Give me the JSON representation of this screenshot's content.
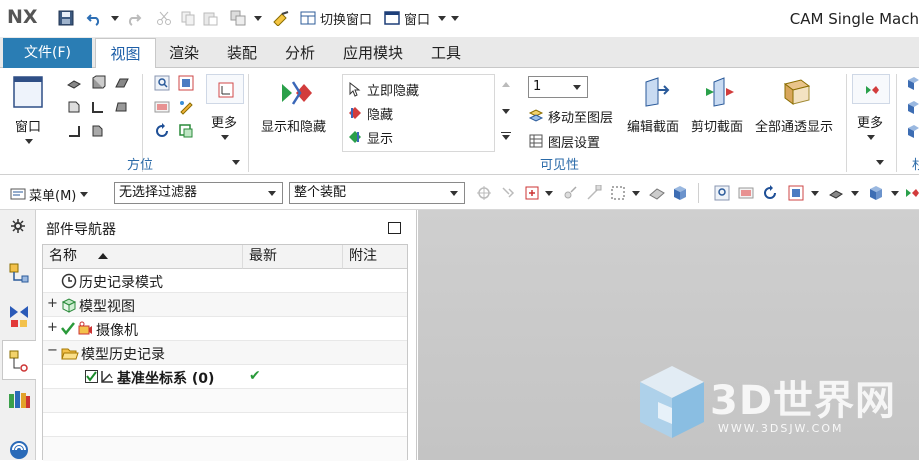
{
  "app": {
    "logo": "NX",
    "title": "CAM Single Mach"
  },
  "quick_access": {
    "switch_window_label": "切换窗口",
    "window_label": "窗口"
  },
  "menu_tabs": {
    "file": "文件(F)",
    "tabs": [
      "视图",
      "渲染",
      "装配",
      "分析",
      "应用模块",
      "工具"
    ]
  },
  "ribbon": {
    "window_btn": "窗口",
    "more_btn_1": "更多",
    "group_orientation": "方位",
    "show_hide_btn": "显示和隐藏",
    "immediate_hide": "立即隐藏",
    "hide": "隐藏",
    "show": "显示",
    "layer_value": "1",
    "move_to_layer": "移动至图层",
    "layer_settings": "图层设置",
    "group_visibility": "可见性",
    "edit_section": "编辑截面",
    "clip_section": "剪切截面",
    "all_see_through": "全部通透显示",
    "more_btn_2": "更多",
    "group_partial": "杉"
  },
  "toolbar2": {
    "menu_label": "菜单(M)",
    "filter_value": "无选择过滤器",
    "scope_value": "整个装配"
  },
  "navigator": {
    "title": "部件导航器",
    "columns": {
      "name": "名称",
      "latest": "最新",
      "note": "附注"
    },
    "items": [
      {
        "label": "历史记录模式",
        "latest": ""
      },
      {
        "label": "模型视图",
        "latest": ""
      },
      {
        "label": "摄像机",
        "latest": ""
      },
      {
        "label": "模型历史记录",
        "latest": ""
      },
      {
        "label": "基准坐标系 (0)",
        "latest": "✔"
      }
    ]
  },
  "watermark": {
    "brand": "3D世界网",
    "url": "WWW.3DSJW.COM"
  },
  "colors": {
    "file_tab": "#2a7db4",
    "accent_blue": "#1e5fa8",
    "check_green": "#3aa53a",
    "viewport": "#c9c9c9"
  }
}
